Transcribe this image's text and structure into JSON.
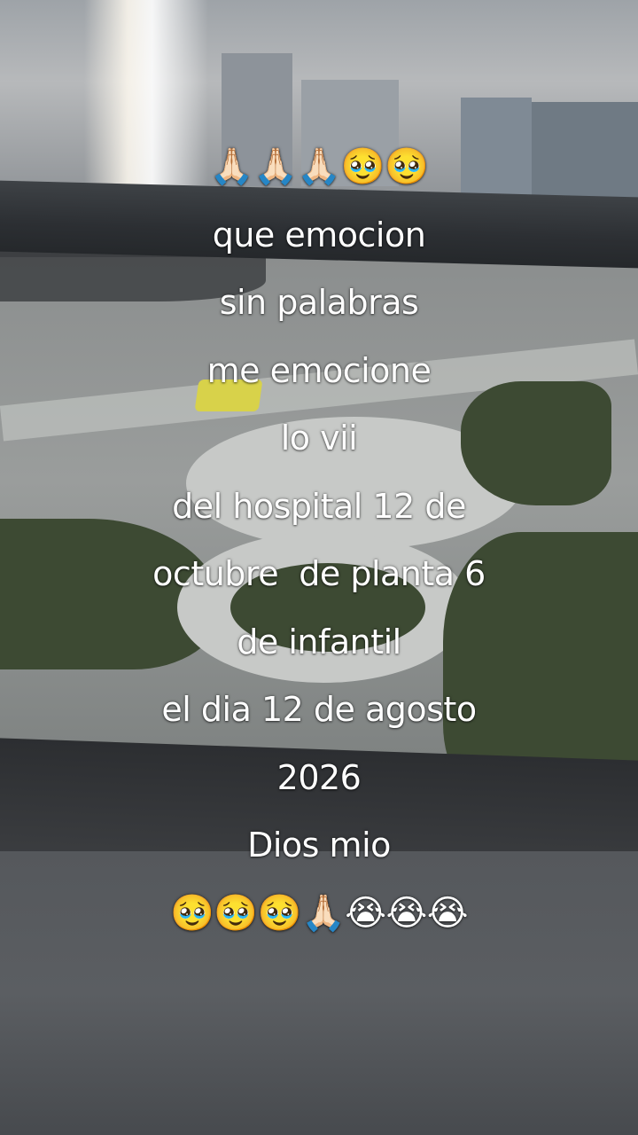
{
  "caption": {
    "lines": [
      "🙏🏻🙏🏻🙏🏻🥹🥹",
      "que emocion",
      "sin palabras",
      "me emocione",
      "lo vii",
      "del hospital 12 de",
      "octubre  de planta 6",
      "de infantil",
      "el dia 12 de agosto",
      "2026",
      "Dios mio",
      "🥹🥹🥹🙏🏻😭😭😭"
    ]
  }
}
